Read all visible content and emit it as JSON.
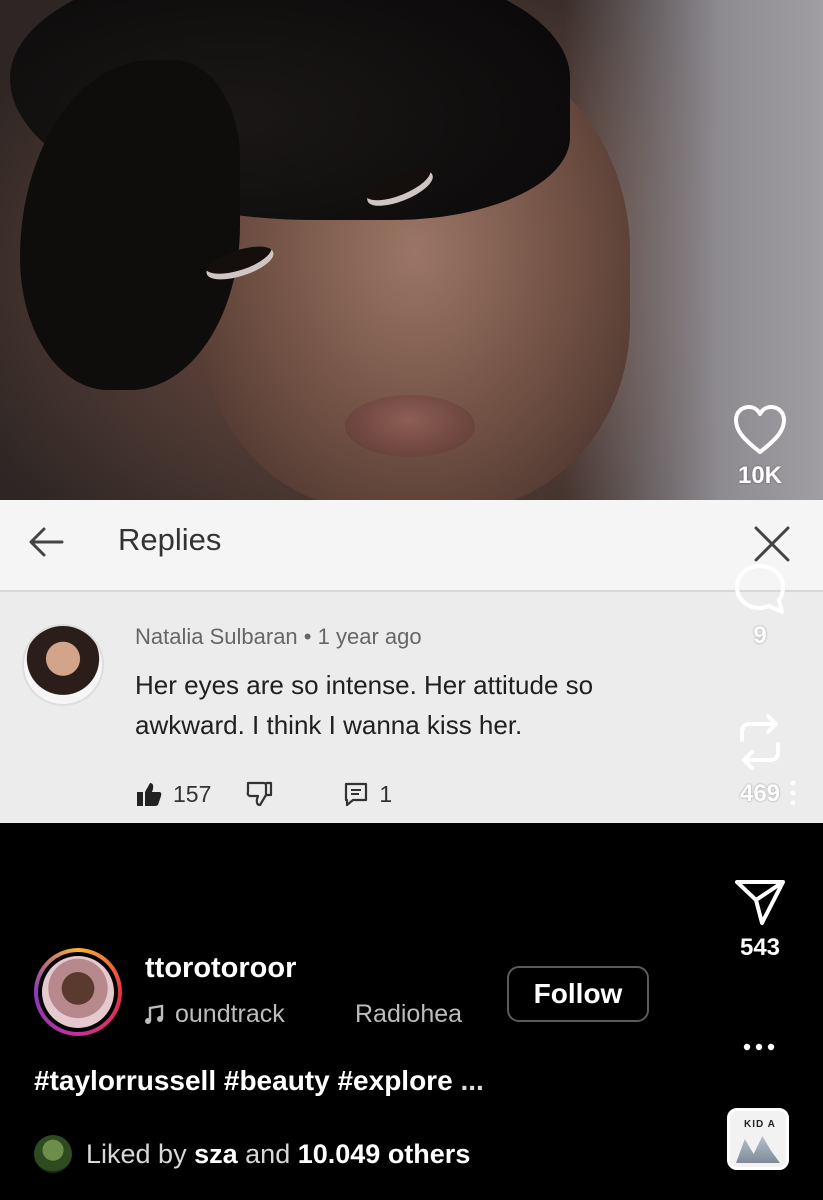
{
  "comment_card": {
    "header_title": "Replies",
    "author": "Natalia Sulbaran",
    "separator": "•",
    "time_ago": "1 year ago",
    "text": "Her eyes are so intense. Her attitude so awkward. I think I wanna kiss her.",
    "like_count": "157",
    "reply_count": "1"
  },
  "rail": {
    "likes": "10K",
    "comments": "9",
    "reposts": "469",
    "shares": "543"
  },
  "post": {
    "username": "ttorotoroor",
    "audio_track": "oundtrack",
    "audio_artist": "Radiohea",
    "follow_label": "Follow",
    "caption": "#taylorrussell #beauty #explore",
    "caption_more": "...",
    "liked_prefix": "Liked by",
    "liked_user": "sza",
    "liked_mid": "and",
    "liked_count": "10.049 others",
    "audio_thumb_text": "KID A"
  },
  "icons": [
    "heart-icon",
    "chat-bubble-icon",
    "repost-icon",
    "send-icon",
    "more-vertical-icon",
    "more-horizontal-icon",
    "music-note-icon",
    "back-arrow-icon",
    "close-icon",
    "thumbs-up-icon",
    "thumbs-down-icon",
    "reply-icon"
  ],
  "colors": {
    "background": "#000000",
    "card": "#ececec",
    "text": "#ffffff",
    "secondary_text": "#bdbdbd"
  }
}
